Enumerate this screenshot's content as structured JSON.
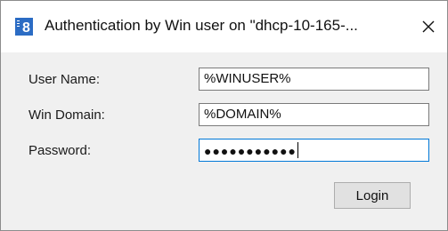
{
  "window": {
    "title": "Authentication by Win user on \"dhcp-10-165-...",
    "app_icon_text": "8",
    "close_glyph": "✕"
  },
  "form": {
    "username_label": "User Name:",
    "username_value": "%WINUSER%",
    "domain_label": "Win Domain:",
    "domain_value": "%DOMAIN%",
    "password_label": "Password:",
    "password_masked": "●●●●●●●●●●●",
    "login_label": "Login"
  },
  "colors": {
    "focus_border": "#0078d7",
    "app_icon_blue": "#2b6cc4"
  },
  "icons": {
    "app": "app-logo-icon",
    "close": "close-icon"
  }
}
